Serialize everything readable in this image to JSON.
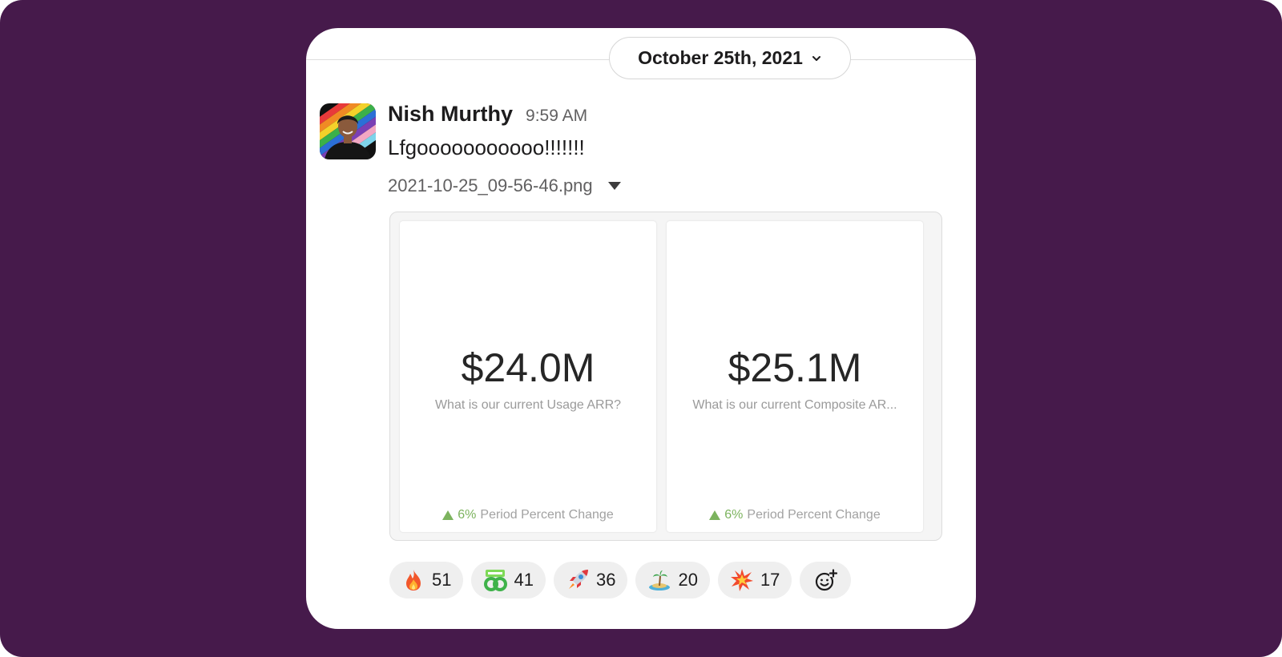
{
  "date_divider": {
    "label": "October 25th, 2021",
    "icon": "chevron-down-icon"
  },
  "message": {
    "author": "Nish Murthy",
    "time": "9:59 AM",
    "text": "Lfgooooooooooo!!!!!!!",
    "attachment": {
      "filename": "2021-10-25_09-56-46.png",
      "icon": "caret-down-icon"
    }
  },
  "preview": {
    "cards": [
      {
        "value": "$24.0M",
        "label": "What is our current Usage ARR?",
        "change_pct": "6%",
        "change_label": "Period Percent Change"
      },
      {
        "value": "$25.1M",
        "label": "What is our current Composite AR...",
        "change_pct": "6%",
        "change_label": "Period Percent Change"
      }
    ],
    "up_color": "#7cb35e"
  },
  "reactions": [
    {
      "emoji": "fire",
      "count": "51"
    },
    {
      "emoji": "lets-go",
      "count": "41"
    },
    {
      "emoji": "rocket",
      "count": "36"
    },
    {
      "emoji": "island",
      "count": "20"
    },
    {
      "emoji": "boom",
      "count": "17"
    }
  ],
  "add_reaction": {
    "icon": "add-reaction-icon"
  },
  "colors": {
    "background": "#461a4b",
    "card": "#ffffff",
    "pill": "#efefef"
  }
}
